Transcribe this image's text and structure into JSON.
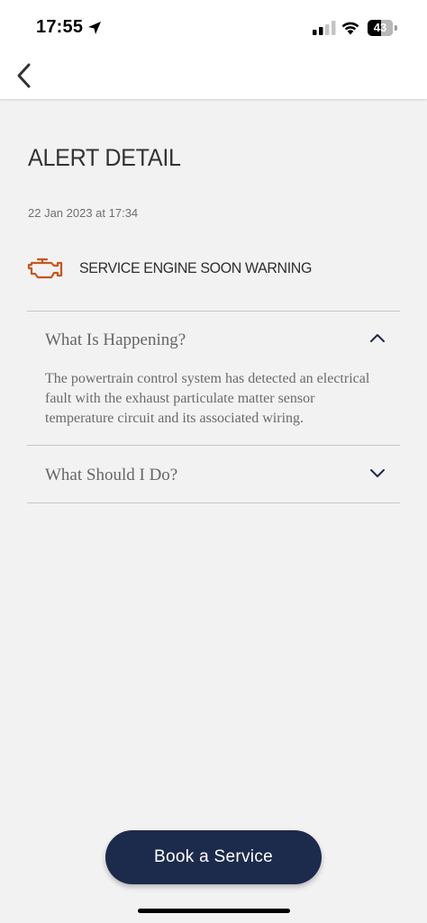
{
  "status_bar": {
    "time": "17:55",
    "battery_level": "43",
    "location_icon": "location-arrow-icon",
    "signal_icon": "cellular-signal-icon",
    "signal_bars_active": 2,
    "signal_bars_total": 4,
    "wifi_icon": "wifi-icon",
    "battery_icon": "battery-icon"
  },
  "nav": {
    "back_icon": "chevron-left-icon"
  },
  "page": {
    "title": "ALERT DETAIL",
    "timestamp": "22 Jan 2023 at 17:34"
  },
  "alert": {
    "icon": "check-engine-icon",
    "icon_color": "#c8561e",
    "title": "SERVICE ENGINE SOON WARNING"
  },
  "sections": [
    {
      "label": "What Is Happening?",
      "expanded": true,
      "chevron": "chevron-up-icon",
      "body": "The powertrain control system has detected an electrical fault with the exhaust particulate matter sensor temperature circuit and its associated wiring."
    },
    {
      "label": "What Should I Do?",
      "expanded": false,
      "chevron": "chevron-down-icon"
    }
  ],
  "actions": {
    "book_service_label": "Book a Service",
    "button_color": "#1c2a4c"
  }
}
